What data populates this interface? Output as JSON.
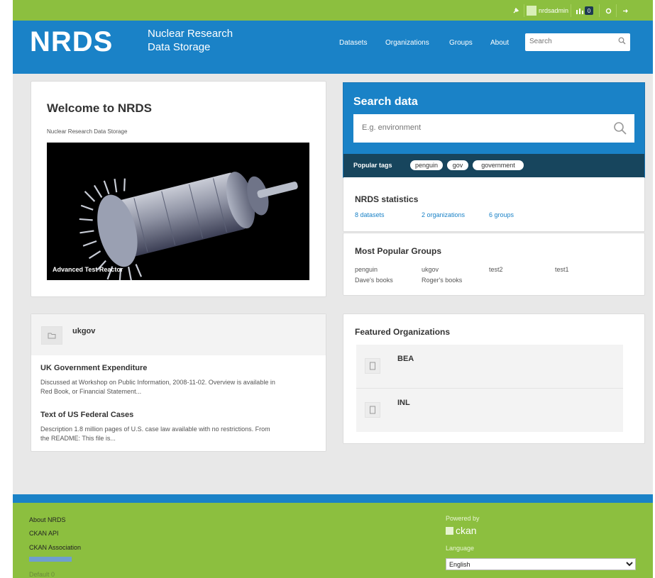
{
  "account": {
    "user": "nrdsadmin",
    "notification_count": "0",
    "colors": {
      "bar": "#8cbf3f",
      "header": "#1a82c7"
    }
  },
  "header": {
    "logo": "NRDS",
    "tagline_line1": "Nuclear Research",
    "tagline_line2": "Data Storage",
    "nav": [
      "Datasets",
      "Organizations",
      "Groups",
      "About"
    ],
    "search_placeholder": "Search"
  },
  "welcome": {
    "title": "Welcome to NRDS",
    "subtitle": "Nuclear Research Data Storage",
    "image_caption": "Advanced Test Reactor"
  },
  "search_data": {
    "title": "Search data",
    "placeholder": "E.g. environment",
    "popular_tags_label": "Popular tags",
    "tags": [
      "penguin",
      "gov",
      "government"
    ]
  },
  "stats": {
    "title": "NRDS statistics",
    "datasets": "8 datasets",
    "organizations": "2 organizations",
    "groups": "6 groups"
  },
  "popular_groups": {
    "title": "Most Popular Groups",
    "items": [
      "penguin",
      "ukgov",
      "test2",
      "test1",
      "Dave's books",
      "Roger's books"
    ]
  },
  "group_activity": {
    "group": "ukgov",
    "datasets": [
      {
        "title": "UK Government Expenditure",
        "desc_line1": "Discussed at Workshop on Public Information, 2008-11-02. Overview is available in",
        "desc_line2": "Red Book, or Financial Statement..."
      },
      {
        "title": "Text of US Federal Cases",
        "desc_line1": "Description 1.8 million pages of U.S. case law available with no restrictions. From",
        "desc_line2": "the README: This file is..."
      }
    ]
  },
  "featured_orgs": {
    "title": "Featured Organizations",
    "items": [
      "BEA",
      "INL"
    ]
  },
  "footer": {
    "links": [
      "About NRDS",
      "CKAN API",
      "CKAN Association",
      "Default 0"
    ],
    "powered_by": "Powered by",
    "ckan": "ckan",
    "language_label": "Language",
    "language": "English"
  }
}
